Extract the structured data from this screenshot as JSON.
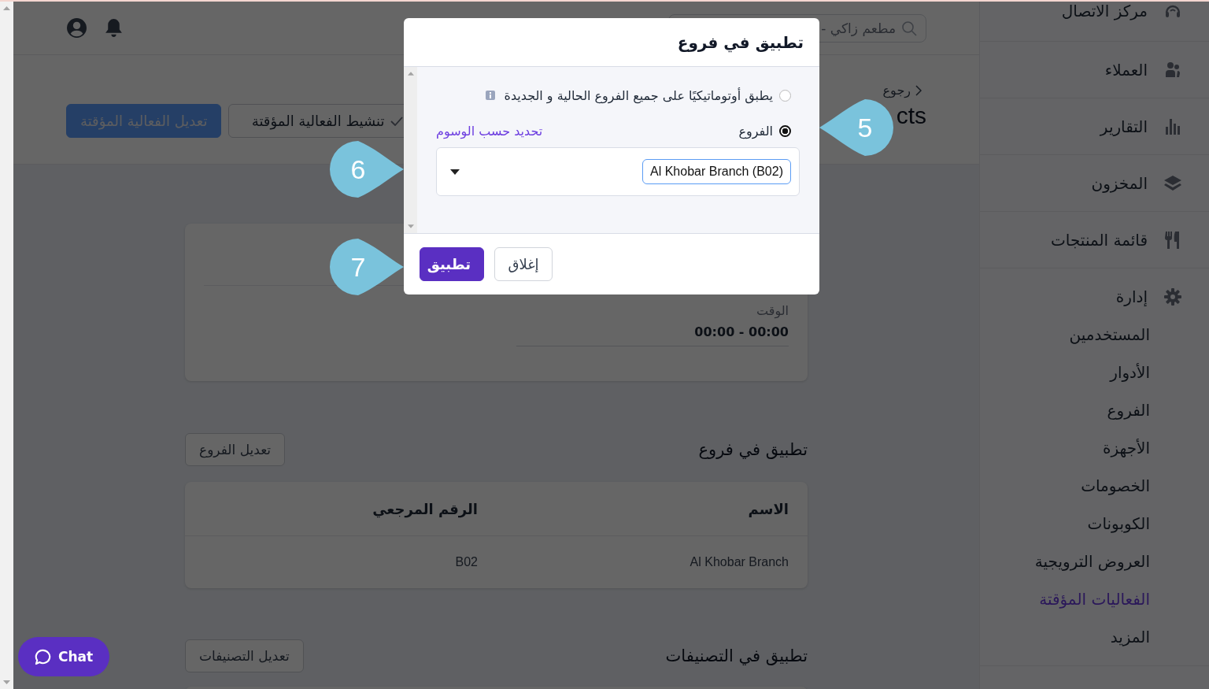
{
  "sidebar": {
    "items": [
      {
        "label": "مركز الاتصال",
        "selected": false
      },
      {
        "label": "العملاء",
        "selected": false
      },
      {
        "label": "التقارير",
        "selected": false
      },
      {
        "label": "المخزون",
        "selected": false
      },
      {
        "label": "قائمة المنتجات",
        "selected": false
      },
      {
        "label": "إدارة",
        "selected": false,
        "children": [
          {
            "label": "المستخدمين",
            "selected": false
          },
          {
            "label": "الأدوار",
            "selected": false
          },
          {
            "label": "الفروع",
            "selected": false
          },
          {
            "label": "الأجهزة",
            "selected": false
          },
          {
            "label": "الخصومات",
            "selected": false
          },
          {
            "label": "الكوبونات",
            "selected": false
          },
          {
            "label": "العروض الترويجية",
            "selected": false
          },
          {
            "label": "الفعاليات المؤقتة",
            "selected": true
          },
          {
            "label": "المزيد",
            "selected": false
          }
        ]
      }
    ]
  },
  "header": {
    "search": {
      "placeholder": "مطعم زاكي -"
    }
  },
  "page": {
    "breadcrumb": "رجوع",
    "title": "cts",
    "buttons": [
      {
        "label": "تنشيط الفعالية المؤقتة",
        "kind": "outline"
      },
      {
        "label": "تعديل الفعالية المؤقتة",
        "kind": "primary"
      }
    ]
  },
  "details": {
    "time_label": "الوقت",
    "time_value": "00:00 - 00:00"
  },
  "branches_section": {
    "title": "تطبيق في فروع",
    "edit_button": "تعديل الفروع",
    "table": {
      "columns": [
        "الاسم",
        "الرقم المرجعي"
      ],
      "rows": [
        [
          "Al Khobar Branch",
          "B02"
        ]
      ]
    }
  },
  "categories_section": {
    "title": "تطبيق في التصنيفات",
    "edit_button": "تعديل التصنيفات"
  },
  "modal": {
    "title": "تطبيق في فروع",
    "options": [
      {
        "label": "يطبق أوتوماتيكيًا على جميع الفروع الحالية و الجديدة",
        "selected": false,
        "info": true
      },
      {
        "label": "الفروع",
        "selected": true,
        "info": false
      }
    ],
    "tag_link": "تحديد حسب الوسوم",
    "selected_branches": [
      "Al Khobar Branch (B02)"
    ],
    "buttons": [
      {
        "label": "إغلاق",
        "kind": "secondary"
      },
      {
        "label": "تطبيق",
        "kind": "primary"
      }
    ]
  },
  "callouts": [
    {
      "number": "5"
    },
    {
      "number": "6"
    },
    {
      "number": "7"
    }
  ],
  "chat": {
    "label": "Chat"
  }
}
